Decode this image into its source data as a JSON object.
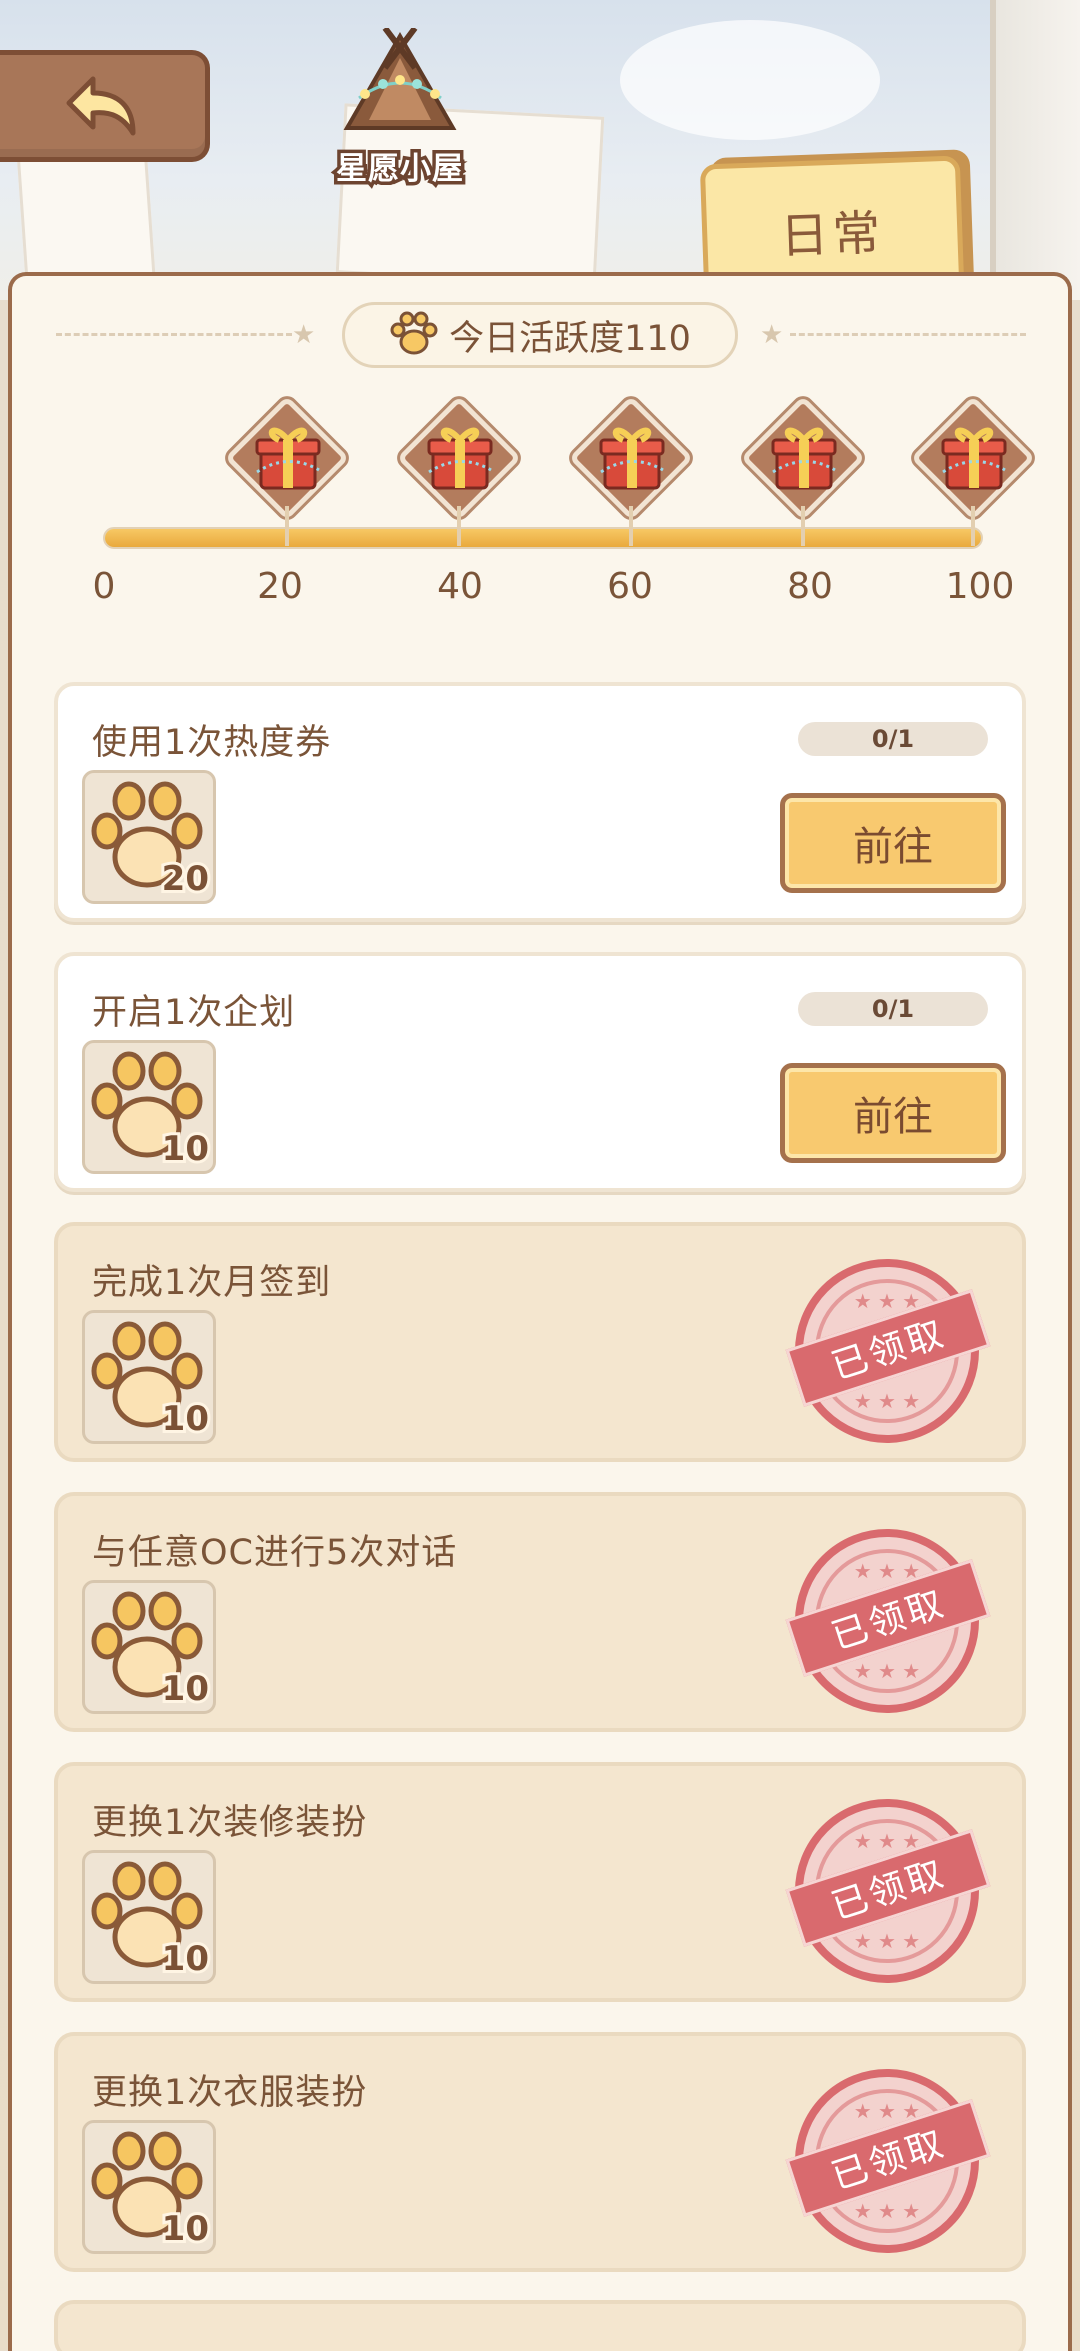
{
  "header": {
    "logo_text": "星愿小屋",
    "tab_label": "日常"
  },
  "activity": {
    "label": "今日活跃度110",
    "progress_fraction": 1.0,
    "milestones": [
      "0",
      "20",
      "40",
      "60",
      "80",
      "100"
    ]
  },
  "tasks": [
    {
      "title": "使用1次热度券",
      "reward": "20",
      "progress": "0/1",
      "button": "前往",
      "state": "open"
    },
    {
      "title": "开启1次企划",
      "reward": "10",
      "progress": "0/1",
      "button": "前往",
      "state": "open"
    },
    {
      "title": "完成1次月签到",
      "reward": "10",
      "stamp": "已领取",
      "state": "claimed"
    },
    {
      "title": "与任意OC进行5次对话",
      "reward": "10",
      "stamp": "已领取",
      "state": "claimed"
    },
    {
      "title": "更换1次装修装扮",
      "reward": "10",
      "stamp": "已领取",
      "state": "claimed"
    },
    {
      "title": "更换1次衣服装扮",
      "reward": "10",
      "stamp": "已领取",
      "state": "claimed"
    }
  ],
  "icons": {
    "back": "back-arrow-icon",
    "paw": "paw-icon",
    "gift": "gift-box-icon",
    "stamp": "claimed-stamp-icon"
  },
  "colors": {
    "accent_orange": "#f7c864",
    "text_brown": "#7a5438",
    "stamp_red": "#d96a6e",
    "panel_bg": "#fbf6ec"
  }
}
